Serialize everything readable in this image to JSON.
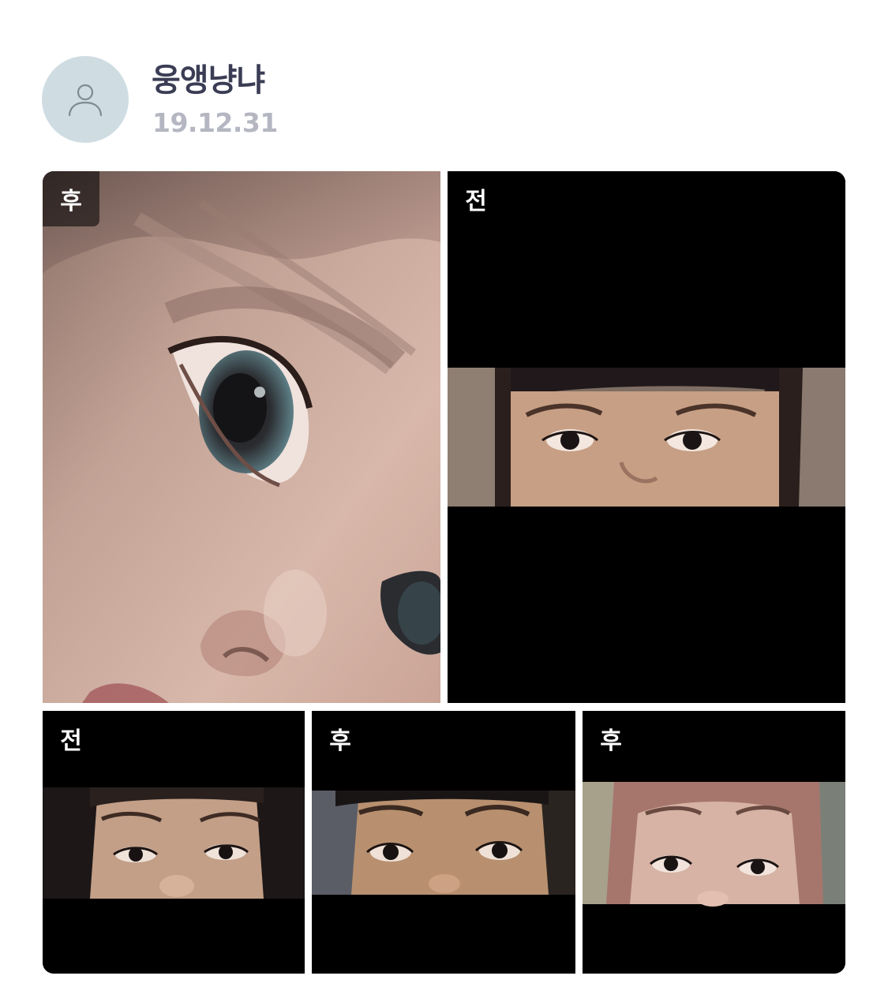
{
  "post": {
    "author": "웅앵냥냐",
    "date": "19.12.31"
  },
  "avatar": {
    "icon": "person-outline-icon",
    "bg_color": "#cfdde3"
  },
  "photos": [
    {
      "label": "후",
      "description": "after"
    },
    {
      "label": "전",
      "description": "before"
    },
    {
      "label": "전",
      "description": "before"
    },
    {
      "label": "후",
      "description": "after"
    },
    {
      "label": "후",
      "description": "after"
    }
  ],
  "colors": {
    "author_text": "#3b3d55",
    "date_text": "#b4b6c2",
    "letterbox": "#000000"
  }
}
